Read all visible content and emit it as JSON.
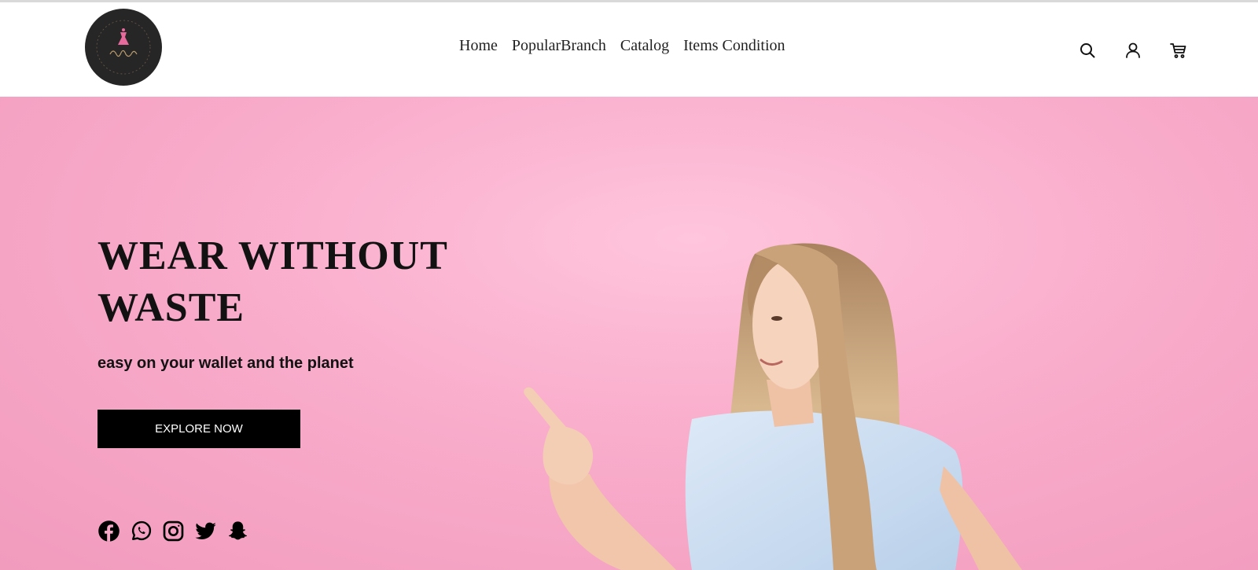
{
  "brand": {
    "logo_icon": "dress-logo-icon"
  },
  "nav": {
    "items": [
      {
        "label": "Home"
      },
      {
        "label": "PopularBranch"
      },
      {
        "label": "Catalog"
      },
      {
        "label": "Items Condition"
      }
    ]
  },
  "header_icons": [
    "search-icon",
    "account-icon",
    "cart-icon"
  ],
  "hero": {
    "title": "WEAR WITHOUT WASTE",
    "subtitle": "easy on your wallet and the planet",
    "button_label": "EXPLORE NOW",
    "background_color": "#f8a9c8"
  },
  "socials": [
    "facebook-icon",
    "whatsapp-icon",
    "instagram-icon",
    "twitter-icon",
    "snapchat-icon"
  ],
  "colors": {
    "header_bg": "#ffffff",
    "button_bg": "#000000",
    "text": "#121212",
    "logo_bg": "#262626",
    "logo_accent": "#e86a9c"
  }
}
